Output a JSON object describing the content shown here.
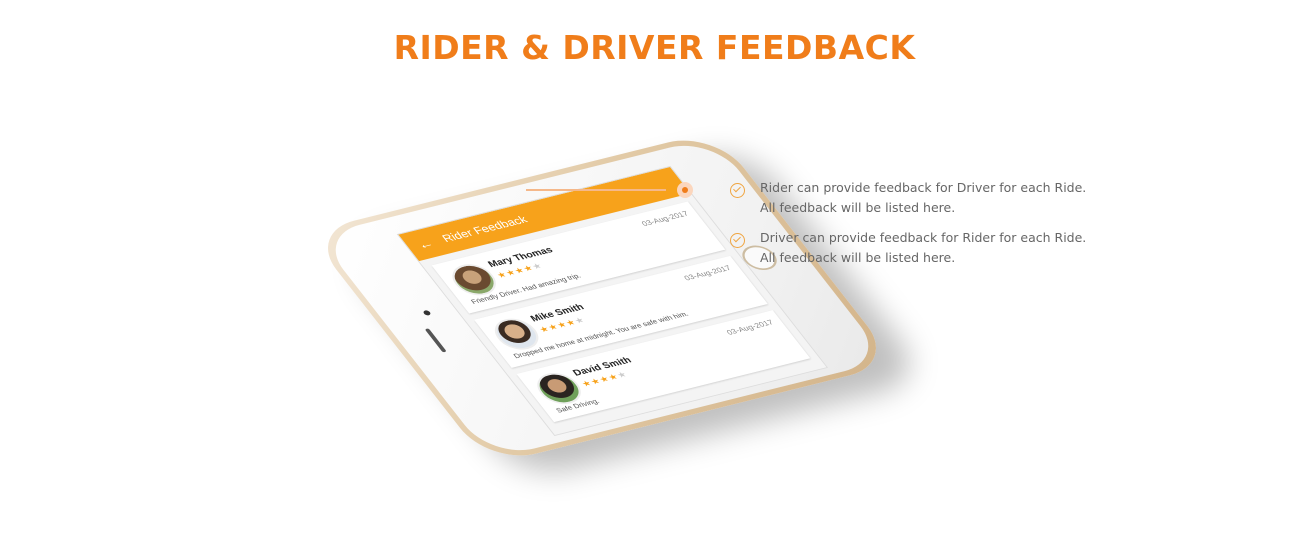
{
  "page": {
    "title": "RIDER & DRIVER FEEDBACK"
  },
  "phone": {
    "app_bar_title": "Rider Feedback",
    "back_icon": "arrow-left-icon",
    "feedbacks": [
      {
        "name": "Mary Thomas",
        "date": "03-Aug-2017",
        "rating": 4,
        "max_rating": 5,
        "comment": "Friendly Driver. Had amazing trip."
      },
      {
        "name": "Mike Smith",
        "date": "03-Aug-2017",
        "rating": 4,
        "max_rating": 5,
        "comment": "Dropped me home at midnight. You are safe with him."
      },
      {
        "name": "David Smith",
        "date": "03-Aug-2017",
        "rating": 4,
        "max_rating": 5,
        "comment": "Safe Driving."
      }
    ]
  },
  "features": [
    {
      "text": "Rider can provide feedback for Driver for each Ride. All feedback will be listed here."
    },
    {
      "text": "Driver can provide feedback for Rider for each Ride. All feedback will be listed here."
    }
  ],
  "colors": {
    "accent": "#f07d1a",
    "app_bar": "#f7a21b",
    "text": "#666666"
  }
}
